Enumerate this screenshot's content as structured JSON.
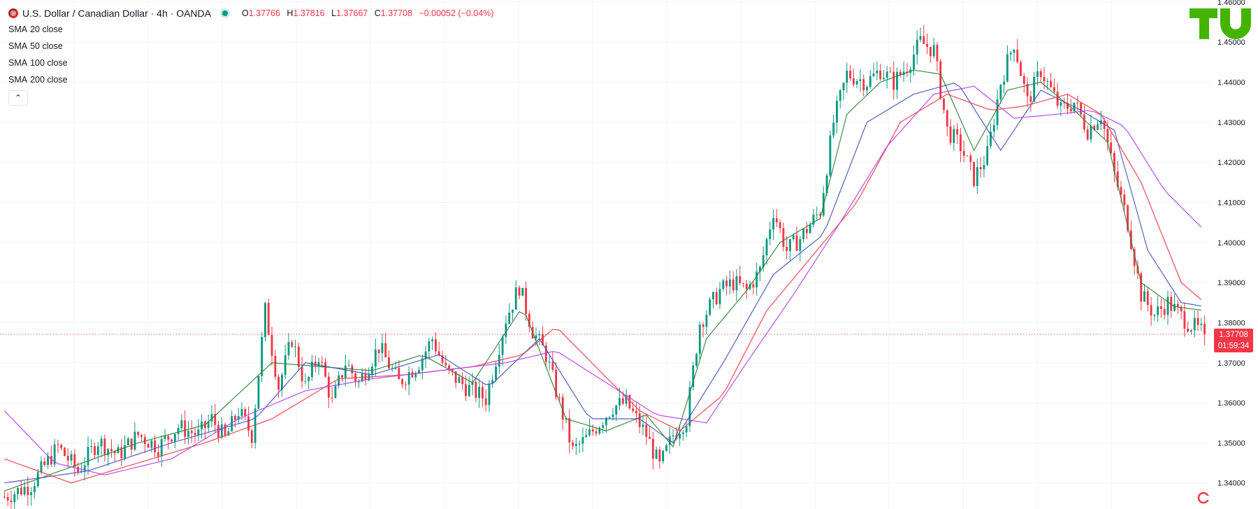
{
  "header": {
    "symbol": "U.S. Dollar / Canadian Dollar · 4h · OANDA",
    "ohlc": [
      {
        "label": "O",
        "value": "1.37766"
      },
      {
        "label": "H",
        "value": "1.37816"
      },
      {
        "label": "L",
        "value": "1.37667"
      },
      {
        "label": "C",
        "value": "1.37708"
      }
    ],
    "change": "−0.00052 (−0.04%)"
  },
  "indicators": [
    {
      "kind": "SMA",
      "params": "20 close",
      "color": "#2e7d32"
    },
    {
      "kind": "SMA",
      "params": "50 close",
      "color": "#3f51b5"
    },
    {
      "kind": "SMA",
      "params": "100 close",
      "color": "#f23645"
    },
    {
      "kind": "SMA",
      "params": "200 close",
      "color": "#b03cf0"
    }
  ],
  "collapse_glyph": "⌃",
  "current_price": {
    "price": "1.37708",
    "countdown": "01:59:34"
  },
  "colors": {
    "up": "#089981",
    "down": "#f23645",
    "grid": "#f0f3fa",
    "axis_text": "#131722"
  },
  "chart_data": {
    "type": "candlestick",
    "y_ticks": [
      "1.34000",
      "1.35000",
      "1.36000",
      "1.37000",
      "1.38000",
      "1.39000",
      "1.40000",
      "1.41000",
      "1.42000",
      "1.43000",
      "1.44000",
      "1.45000",
      "1.46000"
    ],
    "ylim": [
      1.3335,
      1.4605
    ],
    "current_value": 1.37708,
    "bar_count": 360,
    "close_path": [
      [
        0,
        1.3365
      ],
      [
        8,
        1.3395
      ],
      [
        16,
        1.349
      ],
      [
        22,
        1.343
      ],
      [
        28,
        1.3505
      ],
      [
        34,
        1.347
      ],
      [
        40,
        1.352
      ],
      [
        46,
        1.349
      ],
      [
        52,
        1.354
      ],
      [
        58,
        1.352
      ],
      [
        62,
        1.356
      ],
      [
        66,
        1.351
      ],
      [
        70,
        1.358
      ],
      [
        74,
        1.352
      ],
      [
        78,
        1.383
      ],
      [
        82,
        1.364
      ],
      [
        86,
        1.376
      ],
      [
        90,
        1.364
      ],
      [
        94,
        1.372
      ],
      [
        98,
        1.36
      ],
      [
        102,
        1.37
      ],
      [
        106,
        1.365
      ],
      [
        112,
        1.374
      ],
      [
        118,
        1.365
      ],
      [
        124,
        1.37
      ],
      [
        128,
        1.376
      ],
      [
        132,
        1.368
      ],
      [
        138,
        1.364
      ],
      [
        144,
        1.361
      ],
      [
        150,
        1.381
      ],
      [
        154,
        1.389
      ],
      [
        158,
        1.378
      ],
      [
        162,
        1.372
      ],
      [
        166,
        1.36
      ],
      [
        170,
        1.348
      ],
      [
        174,
        1.351
      ],
      [
        178,
        1.355
      ],
      [
        182,
        1.359
      ],
      [
        186,
        1.36
      ],
      [
        192,
        1.352
      ],
      [
        196,
        1.344
      ],
      [
        200,
        1.352
      ],
      [
        204,
        1.356
      ],
      [
        208,
        1.38
      ],
      [
        214,
        1.388
      ],
      [
        218,
        1.39
      ],
      [
        222,
        1.388
      ],
      [
        226,
        1.393
      ],
      [
        230,
        1.408
      ],
      [
        234,
        1.398
      ],
      [
        238,
        1.401
      ],
      [
        244,
        1.408
      ],
      [
        248,
        1.43
      ],
      [
        252,
        1.442
      ],
      [
        258,
        1.44
      ],
      [
        262,
        1.443
      ],
      [
        266,
        1.44
      ],
      [
        270,
        1.444
      ],
      [
        274,
        1.45
      ],
      [
        278,
        1.448
      ],
      [
        282,
        1.428
      ],
      [
        286,
        1.424
      ],
      [
        290,
        1.416
      ],
      [
        294,
        1.422
      ],
      [
        298,
        1.44
      ],
      [
        302,
        1.45
      ],
      [
        306,
        1.435
      ],
      [
        310,
        1.443
      ],
      [
        316,
        1.433
      ],
      [
        320,
        1.435
      ],
      [
        324,
        1.428
      ],
      [
        328,
        1.432
      ],
      [
        332,
        1.417
      ],
      [
        336,
        1.405
      ],
      [
        340,
        1.387
      ],
      [
        344,
        1.382
      ],
      [
        348,
        1.385
      ],
      [
        354,
        1.38
      ],
      [
        359,
        1.37708
      ]
    ],
    "sma": [
      {
        "name": "SMA 20",
        "path": [
          [
            0,
            1.338
          ],
          [
            20,
            1.344
          ],
          [
            40,
            1.35
          ],
          [
            60,
            1.3545
          ],
          [
            80,
            1.37
          ],
          [
            95,
            1.369
          ],
          [
            110,
            1.368
          ],
          [
            125,
            1.372
          ],
          [
            140,
            1.365
          ],
          [
            155,
            1.384
          ],
          [
            168,
            1.356
          ],
          [
            180,
            1.353
          ],
          [
            192,
            1.357
          ],
          [
            200,
            1.349
          ],
          [
            210,
            1.376
          ],
          [
            222,
            1.388
          ],
          [
            232,
            1.4
          ],
          [
            244,
            1.406
          ],
          [
            252,
            1.432
          ],
          [
            262,
            1.44
          ],
          [
            272,
            1.443
          ],
          [
            280,
            1.442
          ],
          [
            290,
            1.423
          ],
          [
            300,
            1.438
          ],
          [
            310,
            1.44
          ],
          [
            320,
            1.433
          ],
          [
            330,
            1.425
          ],
          [
            340,
            1.39
          ],
          [
            350,
            1.384
          ],
          [
            359,
            1.383
          ]
        ]
      },
      {
        "name": "SMA 50",
        "path": [
          [
            0,
            1.34
          ],
          [
            25,
            1.343
          ],
          [
            50,
            1.35
          ],
          [
            75,
            1.356
          ],
          [
            90,
            1.37
          ],
          [
            110,
            1.367
          ],
          [
            130,
            1.372
          ],
          [
            145,
            1.364
          ],
          [
            160,
            1.376
          ],
          [
            175,
            1.356
          ],
          [
            190,
            1.356
          ],
          [
            200,
            1.35
          ],
          [
            215,
            1.37
          ],
          [
            230,
            1.392
          ],
          [
            245,
            1.402
          ],
          [
            258,
            1.43
          ],
          [
            272,
            1.437
          ],
          [
            285,
            1.44
          ],
          [
            298,
            1.423
          ],
          [
            310,
            1.438
          ],
          [
            322,
            1.433
          ],
          [
            332,
            1.428
          ],
          [
            342,
            1.398
          ],
          [
            352,
            1.385
          ],
          [
            359,
            1.384
          ]
        ]
      },
      {
        "name": "SMA 100",
        "path": [
          [
            0,
            1.346
          ],
          [
            20,
            1.34
          ],
          [
            40,
            1.345
          ],
          [
            60,
            1.35
          ],
          [
            80,
            1.356
          ],
          [
            100,
            1.366
          ],
          [
            120,
            1.367
          ],
          [
            140,
            1.369
          ],
          [
            155,
            1.372
          ],
          [
            165,
            1.379
          ],
          [
            178,
            1.368
          ],
          [
            190,
            1.358
          ],
          [
            202,
            1.353
          ],
          [
            215,
            1.362
          ],
          [
            228,
            1.383
          ],
          [
            242,
            1.397
          ],
          [
            255,
            1.41
          ],
          [
            268,
            1.43
          ],
          [
            282,
            1.437
          ],
          [
            295,
            1.433
          ],
          [
            305,
            1.434
          ],
          [
            318,
            1.437
          ],
          [
            328,
            1.432
          ],
          [
            340,
            1.415
          ],
          [
            352,
            1.39
          ],
          [
            359,
            1.385
          ]
        ]
      },
      {
        "name": "SMA 200",
        "path": [
          [
            0,
            1.358
          ],
          [
            15,
            1.345
          ],
          [
            30,
            1.342
          ],
          [
            50,
            1.346
          ],
          [
            70,
            1.356
          ],
          [
            90,
            1.363
          ],
          [
            110,
            1.366
          ],
          [
            130,
            1.368
          ],
          [
            150,
            1.37
          ],
          [
            165,
            1.373
          ],
          [
            180,
            1.365
          ],
          [
            195,
            1.357
          ],
          [
            210,
            1.355
          ],
          [
            222,
            1.37
          ],
          [
            236,
            1.387
          ],
          [
            250,
            1.405
          ],
          [
            264,
            1.424
          ],
          [
            278,
            1.437
          ],
          [
            290,
            1.439
          ],
          [
            302,
            1.431
          ],
          [
            315,
            1.432
          ],
          [
            325,
            1.433
          ],
          [
            335,
            1.429
          ],
          [
            347,
            1.413
          ],
          [
            359,
            1.403
          ]
        ]
      }
    ]
  }
}
